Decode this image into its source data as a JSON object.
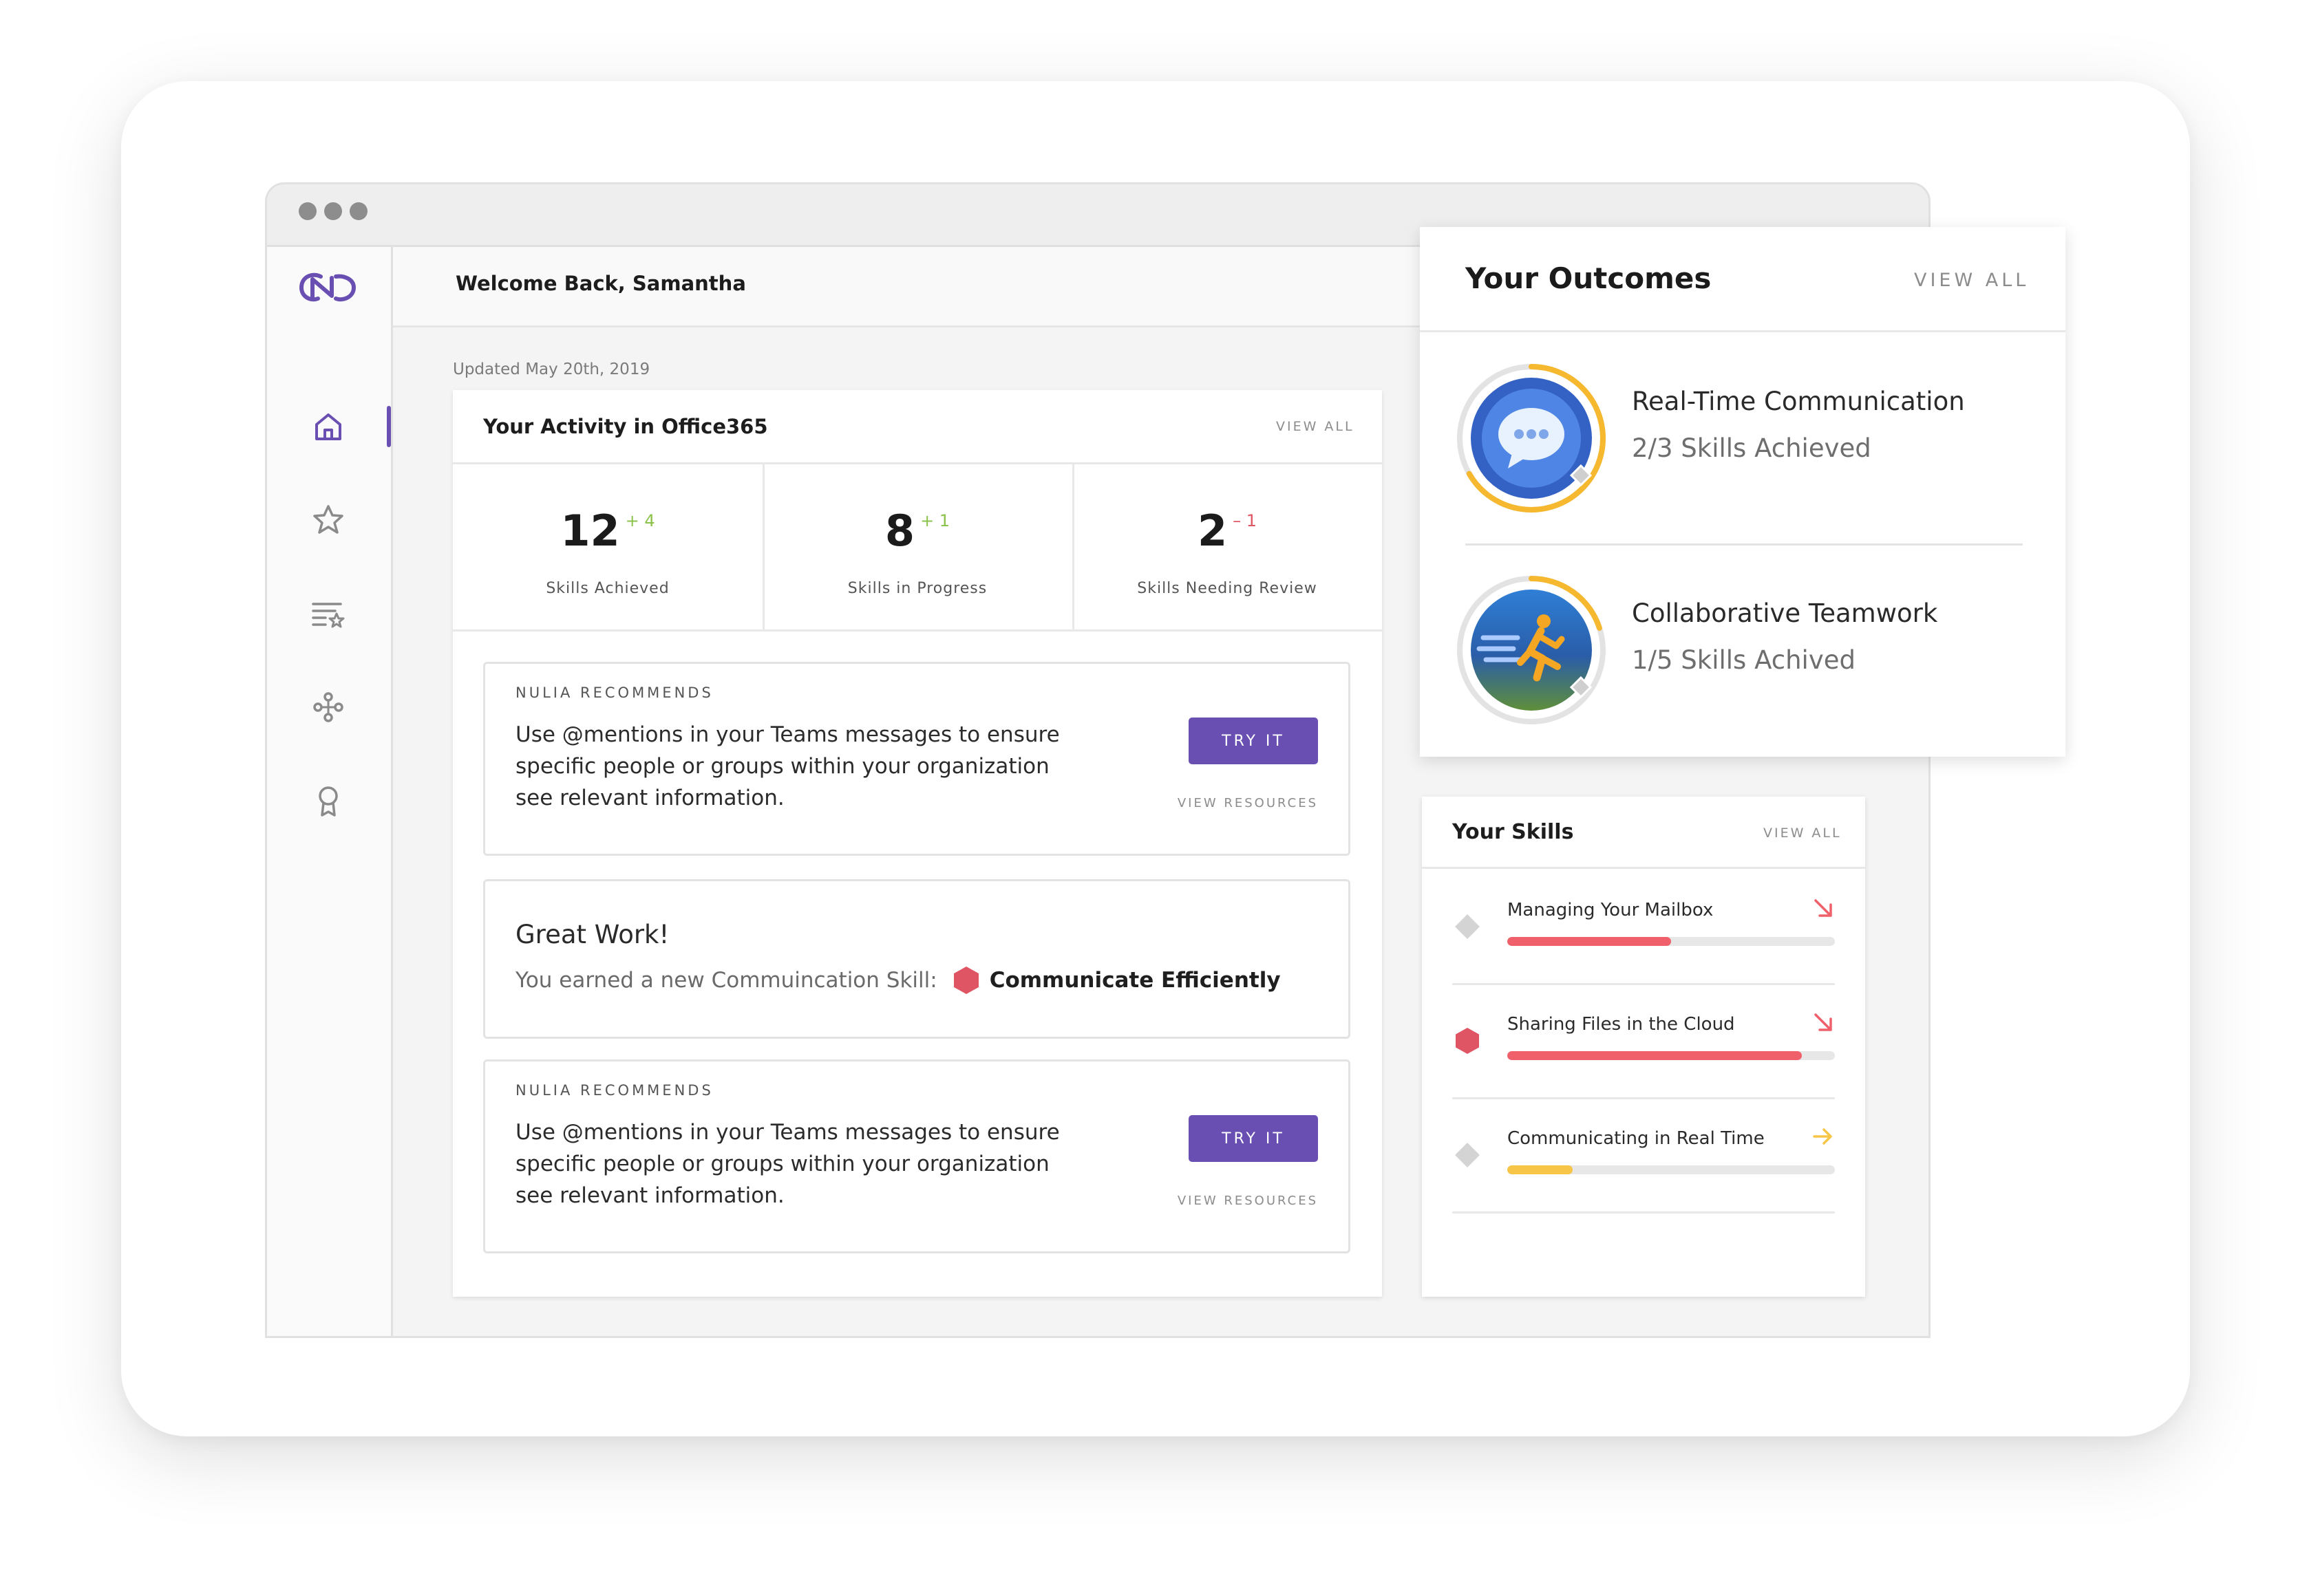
{
  "header": {
    "welcome": "Welcome Back, Samantha",
    "updated": "Updated May 20th, 2019"
  },
  "activity": {
    "title": "Your Activity in Office365",
    "view_all": "VIEW ALL",
    "stats": [
      {
        "value": "12",
        "delta": "+ 4",
        "delta_color": "#8bc34a",
        "label": "Skills Achieved"
      },
      {
        "value": "8",
        "delta": "+ 1",
        "delta_color": "#8bc34a",
        "label": "Skills in Progress"
      },
      {
        "value": "2",
        "delta": "– 1",
        "delta_color": "#e05563",
        "label": "Skills Needing Review"
      }
    ]
  },
  "recommendations": [
    {
      "kicker": "NULIA RECOMMENDS",
      "text": "Use @mentions in your Teams messages to ensure specific people or groups within your organization see relevant information.",
      "button": "TRY IT",
      "resources": "VIEW RESOURCES"
    },
    {
      "kicker": "NULIA RECOMMENDS",
      "text": "Use @mentions in your Teams messages to ensure specific people or groups within your organization see relevant information.",
      "button": "TRY IT",
      "resources": "VIEW RESOURCES"
    }
  ],
  "great_work": {
    "title": "Great Work!",
    "text": "You earned a new Commuincation Skill:",
    "skill": "Communicate Efficiently"
  },
  "outcomes": {
    "title": "Your Outcomes",
    "view_all": "VIEW ALL",
    "items": [
      {
        "name": "Real-Time Communication",
        "progress_text": "2/3 Skills Achieved",
        "progress": 0.667,
        "icon": "chat-bubble-icon"
      },
      {
        "name": "Collaborative Teamwork",
        "progress_text": "1/5 Skills Achived",
        "progress": 0.2,
        "icon": "running-person-icon"
      }
    ]
  },
  "skills": {
    "title": "Your Skills",
    "view_all": "VIEW ALL",
    "items": [
      {
        "name": "Managing Your Mailbox",
        "progress": 0.5,
        "color": "#f0606a",
        "trend": "down",
        "icon": "diamond-icon"
      },
      {
        "name": "Sharing Files in the Cloud",
        "progress": 0.9,
        "color": "#f0606a",
        "trend": "down",
        "icon": "hexagon-icon"
      },
      {
        "name": "Communicating in Real Time",
        "progress": 0.2,
        "color": "#f7c547",
        "trend": "flat",
        "icon": "diamond-icon"
      }
    ]
  },
  "colors": {
    "accent": "#6a4fb3",
    "positive": "#8bc34a",
    "negative": "#e05563",
    "warning": "#f7c547"
  },
  "nav": [
    "home-icon",
    "star-icon",
    "list-star-icon",
    "network-icon",
    "award-icon"
  ]
}
